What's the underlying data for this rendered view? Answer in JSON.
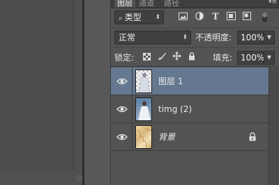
{
  "panel": {
    "tabs": [
      {
        "label": "图层",
        "active": true
      },
      {
        "label": "通道",
        "active": false
      },
      {
        "label": "路径",
        "active": false
      }
    ],
    "filter": {
      "kind_label": "类型",
      "filter_icons": [
        "image-filter-icon",
        "adjustment-filter-icon",
        "type-filter-icon",
        "shape-filter-icon",
        "smart-object-filter-icon"
      ]
    },
    "blend": {
      "mode": "正常",
      "opacity_label": "不透明度:",
      "opacity_value": "100%"
    },
    "lock": {
      "label": "锁定:",
      "fill_label": "填充:",
      "fill_value": "100%"
    },
    "layers": [
      {
        "name": "图层 1",
        "selected": true,
        "visible": true,
        "locked": false
      },
      {
        "name": "timg (2)",
        "selected": false,
        "visible": true,
        "locked": false
      },
      {
        "name": "背景",
        "selected": false,
        "visible": true,
        "locked": true
      }
    ],
    "colors": {
      "selected_row": "#64788f",
      "panel_bg": "#535353",
      "field_bg": "#404040"
    }
  }
}
